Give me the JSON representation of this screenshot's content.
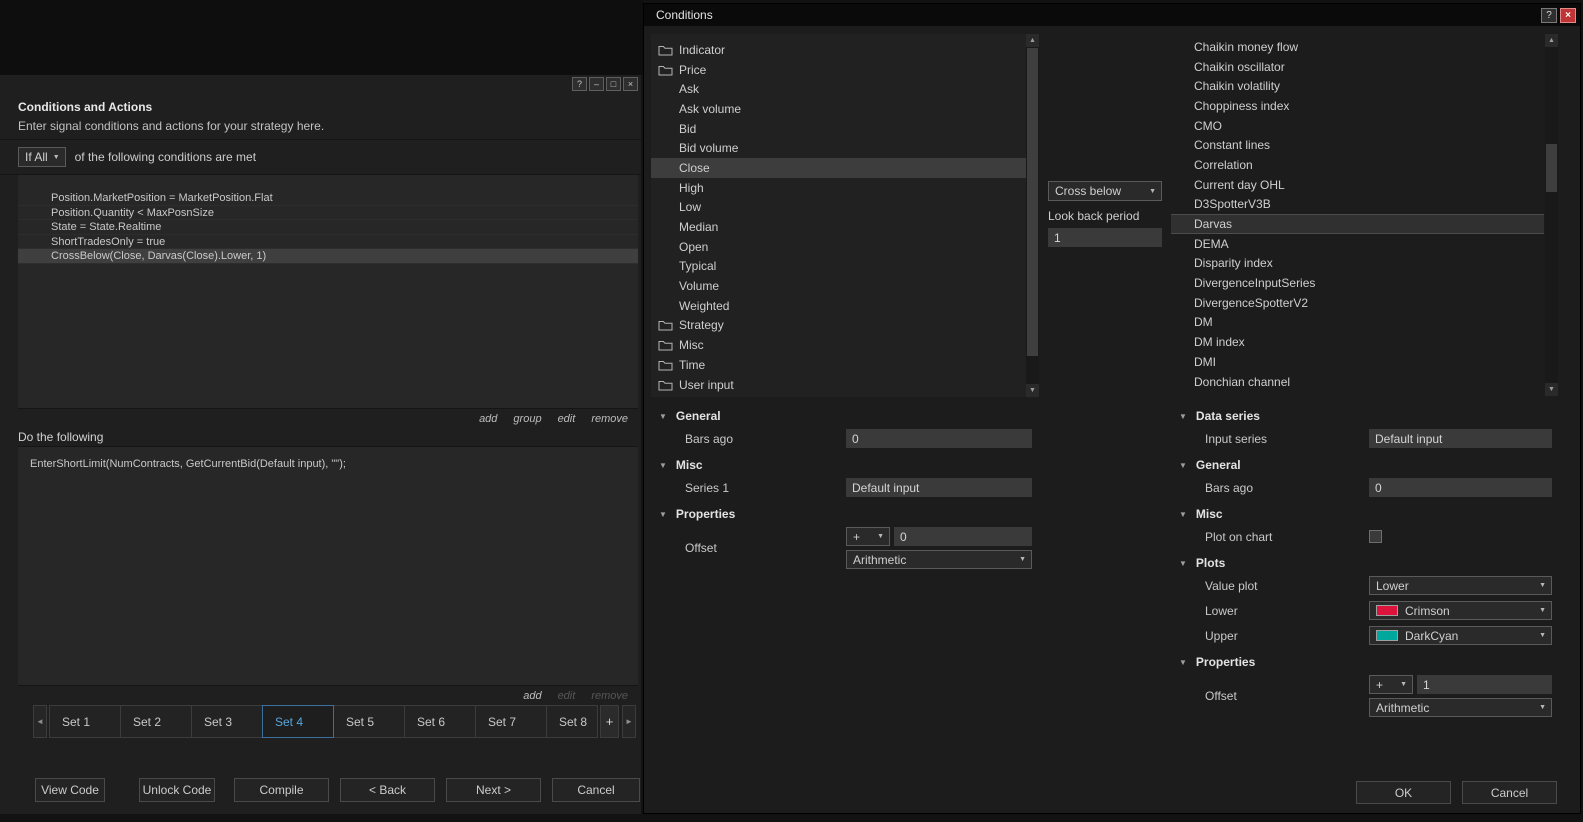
{
  "colors": {
    "accent_blue": "#58A6DC",
    "crimson": "#DC143C",
    "darkcyan": "#00A79C"
  },
  "left_window": {
    "titlebar": {
      "help": "?",
      "minimize": "–",
      "maximize": "□",
      "close": "×"
    },
    "header": {
      "title": "Conditions and Actions",
      "subtitle": "Enter signal conditions and actions for your strategy here."
    },
    "builder": {
      "match_value": "If All",
      "match_suffix": "of the following conditions are met"
    },
    "conditions": [
      {
        "text": "Position.MarketPosition = MarketPosition.Flat"
      },
      {
        "text": "Position.Quantity < MaxPosnSize"
      },
      {
        "text": "State = State.Realtime"
      },
      {
        "text": "ShortTradesOnly = true"
      },
      {
        "text": "CrossBelow(Close, Darvas(Close).Lower, 1)",
        "selected": true
      }
    ],
    "condition_links": [
      {
        "label": "add"
      },
      {
        "label": "group"
      },
      {
        "label": "edit"
      },
      {
        "label": "remove"
      }
    ],
    "actions_label": "Do the following",
    "actions": [
      {
        "text": "EnterShortLimit(NumContracts, GetCurrentBid(Default input), \"\");"
      }
    ],
    "action_links": [
      {
        "label": "add"
      },
      {
        "label": "edit",
        "disabled": true
      },
      {
        "label": "remove",
        "disabled": true
      }
    ],
    "tabs": [
      {
        "label": "Set 1"
      },
      {
        "label": "Set 2"
      },
      {
        "label": "Set 3"
      },
      {
        "label": "Set 4",
        "active": true
      },
      {
        "label": "Set 5"
      },
      {
        "label": "Set 6"
      },
      {
        "label": "Set 7"
      },
      {
        "label": "Set 8"
      }
    ],
    "tab_add": "+",
    "tab_prev": "◄",
    "tab_next": "►",
    "footer": {
      "view_code": "View Code",
      "unlock_code": "Unlock Code",
      "compile": "Compile",
      "back": "< Back",
      "next": "Next >",
      "cancel": "Cancel"
    }
  },
  "dialog": {
    "title": "Conditions",
    "titlebar": {
      "help": "?",
      "close": "×"
    },
    "tree": [
      {
        "label": "Indicator",
        "kind": "folder"
      },
      {
        "label": "Price",
        "kind": "folder"
      },
      {
        "label": "Ask",
        "kind": "item"
      },
      {
        "label": "Ask volume",
        "kind": "item"
      },
      {
        "label": "Bid",
        "kind": "item"
      },
      {
        "label": "Bid volume",
        "kind": "item"
      },
      {
        "label": "Close",
        "kind": "item",
        "selected": true
      },
      {
        "label": "High",
        "kind": "item"
      },
      {
        "label": "Low",
        "kind": "item"
      },
      {
        "label": "Median",
        "kind": "item"
      },
      {
        "label": "Open",
        "kind": "item"
      },
      {
        "label": "Typical",
        "kind": "item"
      },
      {
        "label": "Volume",
        "kind": "item"
      },
      {
        "label": "Weighted",
        "kind": "item"
      },
      {
        "label": "Strategy",
        "kind": "folder"
      },
      {
        "label": "Misc",
        "kind": "folder"
      },
      {
        "label": "Time",
        "kind": "folder"
      },
      {
        "label": "User input",
        "kind": "folder"
      }
    ],
    "operator": {
      "value": "Cross below",
      "lookback_label": "Look back period",
      "lookback_value": "1"
    },
    "indicators": [
      {
        "label": "Chaikin money flow"
      },
      {
        "label": "Chaikin oscillator"
      },
      {
        "label": "Chaikin volatility"
      },
      {
        "label": "Choppiness index"
      },
      {
        "label": "CMO"
      },
      {
        "label": "Constant lines"
      },
      {
        "label": "Correlation"
      },
      {
        "label": "Current day OHL"
      },
      {
        "label": "D3SpotterV3B"
      },
      {
        "label": "Darvas",
        "selected": true
      },
      {
        "label": "DEMA"
      },
      {
        "label": "Disparity index"
      },
      {
        "label": "DivergenceInputSeries"
      },
      {
        "label": "DivergenceSpotterV2"
      },
      {
        "label": "DM"
      },
      {
        "label": "DM index"
      },
      {
        "label": "DMI"
      },
      {
        "label": "Donchian channel"
      }
    ],
    "left_props": {
      "general_header": "General",
      "bars_ago_label": "Bars ago",
      "bars_ago_value": "0",
      "misc_header": "Misc",
      "series1_label": "Series 1",
      "series1_value": "Default input",
      "properties_header": "Properties",
      "offset_label": "Offset",
      "offset_op": "+",
      "offset_value": "0",
      "offset_mode": "Arithmetic"
    },
    "right_props": {
      "data_series_header": "Data series",
      "input_series_label": "Input series",
      "input_series_value": "Default input",
      "general_header": "General",
      "bars_ago_label": "Bars ago",
      "bars_ago_value": "0",
      "misc_header": "Misc",
      "plot_on_chart_label": "Plot on chart",
      "plots_header": "Plots",
      "value_plot_label": "Value plot",
      "value_plot_value": "Lower",
      "lower_label": "Lower",
      "lower_value": "Crimson",
      "lower_color": "#DC143C",
      "upper_label": "Upper",
      "upper_value": "DarkCyan",
      "upper_color": "#00A79C",
      "properties_header": "Properties",
      "offset_label": "Offset",
      "offset_op": "+",
      "offset_value": "1",
      "offset_mode": "Arithmetic"
    },
    "footer": {
      "ok": "OK",
      "cancel": "Cancel"
    }
  }
}
